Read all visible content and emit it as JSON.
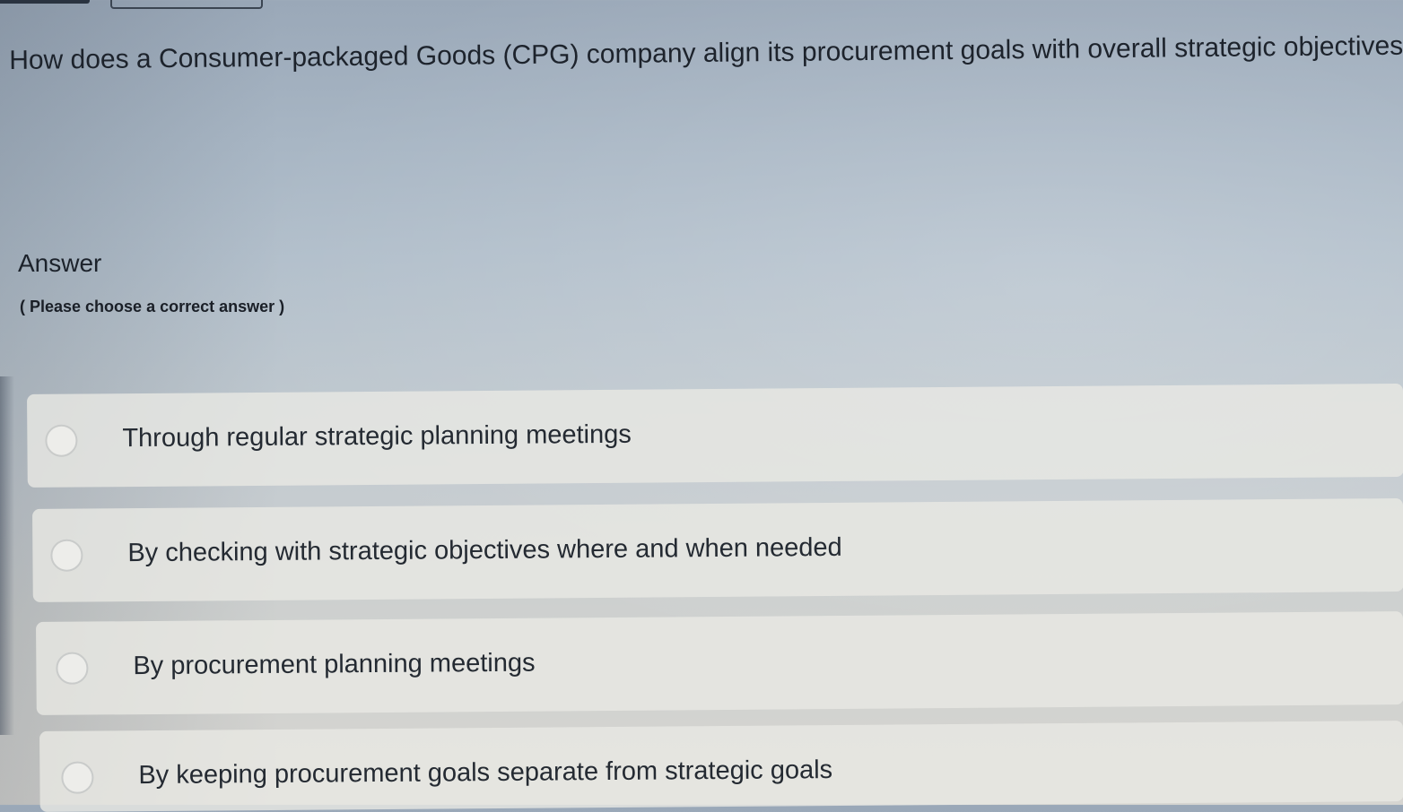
{
  "question": {
    "text": "How does a Consumer-packaged Goods (CPG) company align its procurement goals with overall strategic objectives?"
  },
  "answer": {
    "heading": "Answer",
    "instruction": "( Please choose a correct answer )",
    "options": [
      {
        "label": "Through regular strategic planning meetings"
      },
      {
        "label": "By checking with strategic objectives where and when needed"
      },
      {
        "label": "By procurement planning meetings"
      },
      {
        "label": "By keeping procurement goals separate from strategic goals"
      }
    ]
  }
}
